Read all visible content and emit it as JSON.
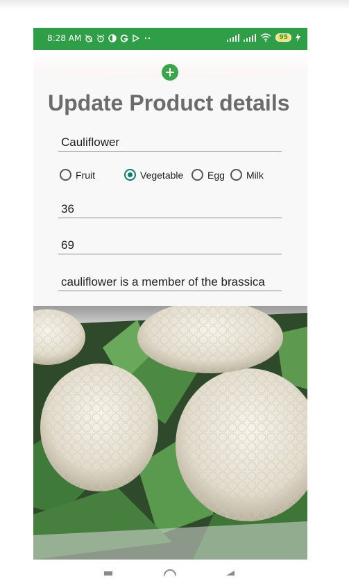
{
  "status_bar": {
    "time": "8:28 AM",
    "battery": "95",
    "icons": [
      "alarm-off-icon",
      "alarm-icon",
      "contrast-icon",
      "google-icon",
      "play-outline-icon",
      "more-dots-icon"
    ],
    "signal_icons": [
      "signal-icon",
      "signal-icon",
      "wifi-icon",
      "battery-icon",
      "charging-icon"
    ]
  },
  "header": {
    "add_icon": "plus-icon",
    "title": "Update Product details"
  },
  "form": {
    "name_value": "Cauliflower",
    "categories": [
      {
        "label": "Fruit",
        "checked": false
      },
      {
        "label": "Vegetable",
        "checked": true
      },
      {
        "label": "Egg",
        "checked": false
      },
      {
        "label": "Milk",
        "checked": false
      }
    ],
    "field_2_value": "36",
    "field_3_value": "69",
    "description_value": "cauliflower is a member of the brassica"
  },
  "colors": {
    "status_bar": "#2e9e47",
    "accent_radio": "#0c7e6e",
    "title": "#6b6b6b"
  }
}
